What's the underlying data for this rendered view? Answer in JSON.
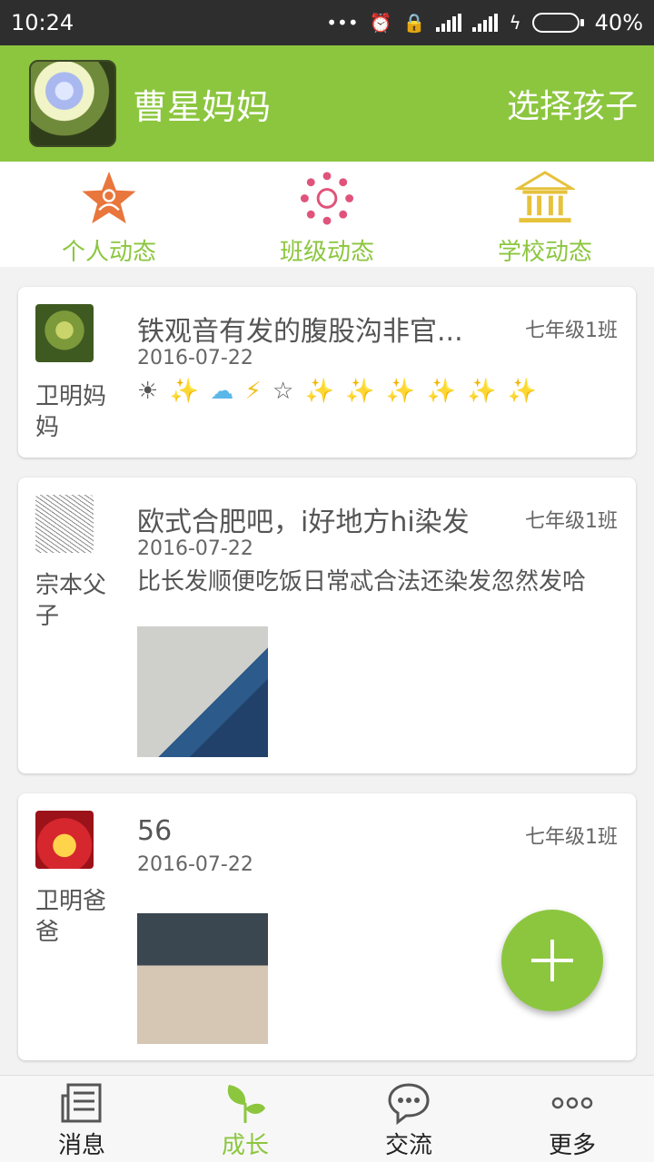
{
  "status_bar": {
    "time": "10:24",
    "battery_percent": "40%",
    "battery_level": 0.4,
    "icons": [
      "dots-icon",
      "alarm-icon",
      "lock-icon",
      "signal-icon",
      "signal-icon",
      "charging-icon",
      "battery-icon"
    ]
  },
  "header": {
    "parent_name": "曹星妈妈",
    "choose_child_label": "选择孩子"
  },
  "categories": [
    {
      "label": "个人动态",
      "icon": "star-person-icon",
      "color": "#e9763c"
    },
    {
      "label": "班级动态",
      "icon": "circle-dots-icon",
      "color": "#e0537a"
    },
    {
      "label": "学校动态",
      "icon": "school-building-icon",
      "color": "#e6c13c"
    }
  ],
  "feed": [
    {
      "author": "卫明妈妈",
      "title": "铁观音有发的腹股沟非官...",
      "class_name": "七年级1班",
      "date": "2016-07-22",
      "emoji": [
        "☀",
        "✨",
        "☁",
        "⚡",
        "☆",
        "✨",
        "✨",
        "✨",
        "✨",
        "✨",
        "✨"
      ]
    },
    {
      "author": "宗本父子",
      "title": "欧式合肥吧，i好地方hi染发",
      "class_name": "七年级1班",
      "date": "2016-07-22",
      "body": "比长发顺便吃饭日常忒合法还染发忽然发哈"
    },
    {
      "author": "卫明爸爸",
      "title": "56",
      "class_name": "七年级1班",
      "date": "2016-07-22"
    }
  ],
  "bottom_nav": [
    {
      "label": "消息",
      "icon": "newspaper-icon"
    },
    {
      "label": "成长",
      "icon": "sprout-icon",
      "active": true
    },
    {
      "label": "交流",
      "icon": "chat-bubble-icon"
    },
    {
      "label": "更多",
      "icon": "more-dots-icon"
    }
  ],
  "colors": {
    "brand_green": "#8cc63f",
    "status_bar": "#2e2e2e"
  }
}
